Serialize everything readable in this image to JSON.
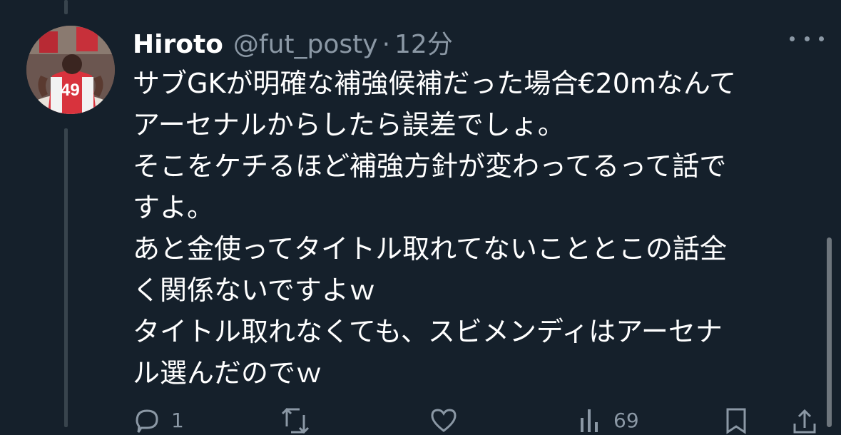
{
  "tweet": {
    "display_name": "Hiroto",
    "handle": "@fut_posty",
    "separator": "·",
    "time": "12分",
    "text_lines": [
      "サブGKが明確な補強候補だった場合€20mなんて",
      "アーセナルからしたら誤差でしょ。",
      "そこをケチるほど補強方針が変わってるって話で",
      "すよ。",
      "あと金使ってタイトル取れてないこととこの話全",
      "く関係ないですよｗ",
      "タイトル取れなくても、スビメンディはアーセナ",
      "ル選んだのでｗ"
    ]
  },
  "actions": {
    "reply_count": "1",
    "retweet_count": "",
    "like_count": "",
    "views_count": "69"
  },
  "icons": {
    "reply": "reply-icon",
    "retweet": "retweet-icon",
    "like": "heart-icon",
    "views": "views-icon",
    "bookmark": "bookmark-icon",
    "share": "share-icon",
    "more": "more-icon"
  },
  "colors": {
    "background": "#15202b",
    "primary_text": "#ffffff",
    "secondary_text": "#8b98a5",
    "thread_line": "#38444d"
  }
}
